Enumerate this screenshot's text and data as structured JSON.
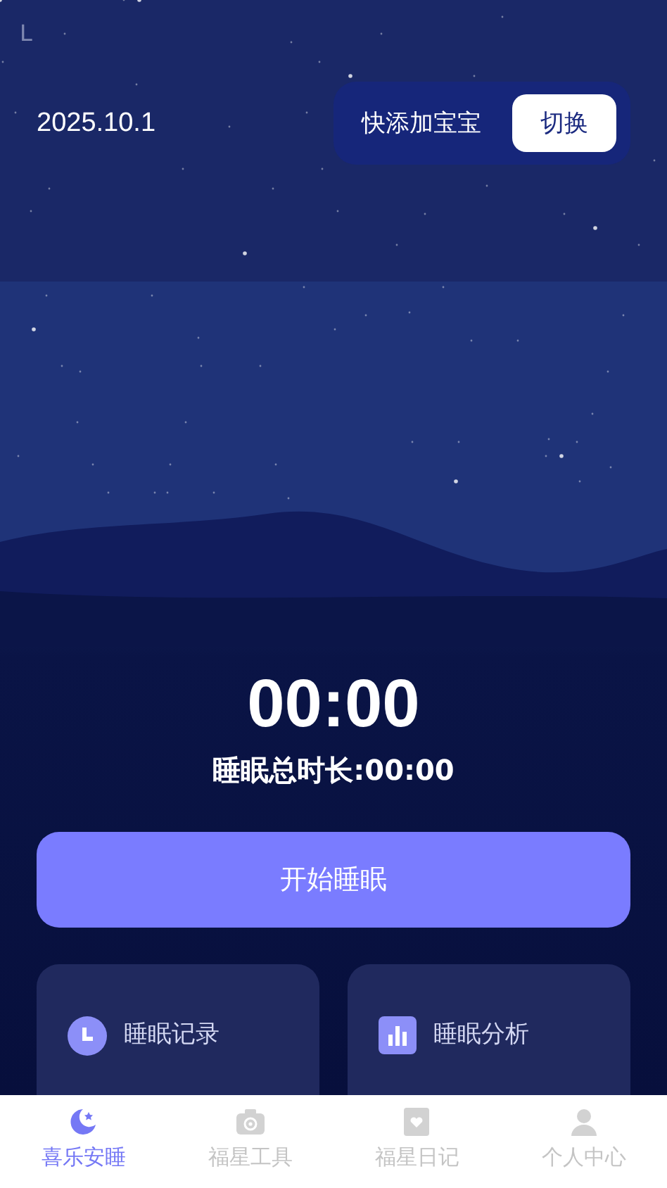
{
  "status_bar": {
    "text": "L"
  },
  "header": {
    "date": "2025.10.1",
    "baby_label": "快添加宝宝",
    "switch_button": "切换"
  },
  "timer": {
    "time": "00:00",
    "total": "睡眠总时长:00:00"
  },
  "start_button": "开始睡眠",
  "cards": [
    {
      "kind": "clock",
      "label": "睡眠记录"
    },
    {
      "kind": "chart",
      "label": "睡眠分析"
    }
  ],
  "tabs": [
    {
      "kind": "moon",
      "label": "喜乐安睡",
      "selected": true
    },
    {
      "kind": "camera",
      "label": "福星工具",
      "selected": false
    },
    {
      "kind": "diary",
      "label": "福星日记",
      "selected": false
    },
    {
      "kind": "person",
      "label": "个人中心",
      "selected": false
    }
  ]
}
